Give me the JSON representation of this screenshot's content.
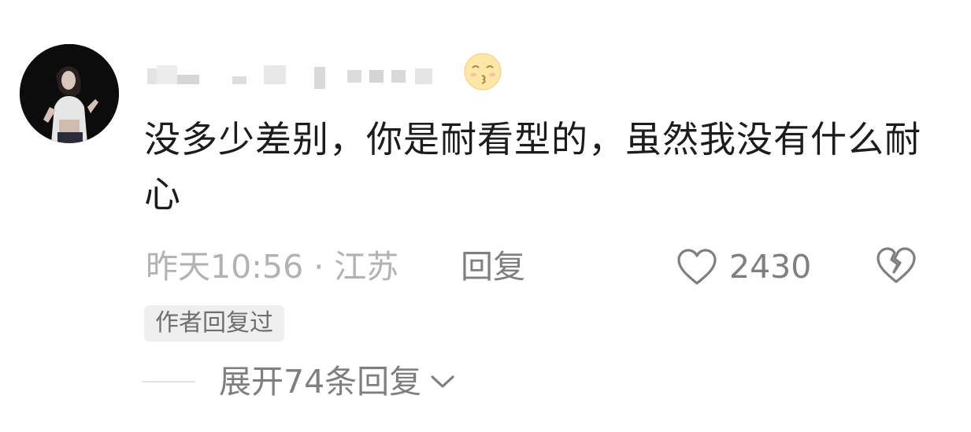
{
  "comment": {
    "text": "没多少差别，你是耐看型的，虽然我没有什么耐心",
    "time_location": "昨天10:56 · 江苏",
    "reply_label": "回复",
    "like_count": "2430",
    "author_replied_badge": "作者回复过",
    "expand_replies_label": "展开74条回复"
  },
  "icons": {
    "avatar": "avatar-photo",
    "emoji": "kissing-face-emoji",
    "like": "heart-outline-icon",
    "dislike": "broken-heart-icon",
    "expand": "chevron-down-icon"
  },
  "colors": {
    "text_primary": "#1c1c1c",
    "text_secondary": "#7f7f7f",
    "text_tertiary": "#b2b2b2",
    "badge_bg": "#efefef"
  }
}
